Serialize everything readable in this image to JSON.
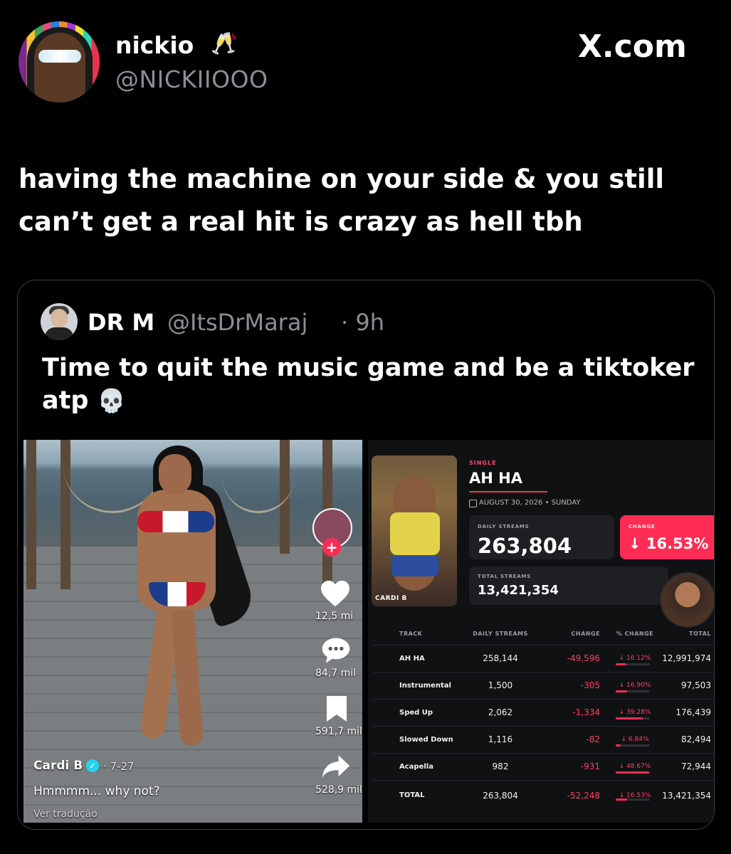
{
  "tweet": {
    "user_name": "nickio",
    "name_emoji": "🥂",
    "user_handle": "@NICKIIOOO",
    "site": "X.com",
    "text": "having the machine on your side & you still can’t get a real hit is crazy as hell tbh"
  },
  "quote": {
    "name": "DR M",
    "handle": "@ItsDrMaraj",
    "time": "· 9h",
    "text": "Time to quit the music game and be a tiktoker atp",
    "emoji": "💀"
  },
  "video": {
    "like_count": "12,5 mi",
    "comment_count": "84,7 mil",
    "save_count": "591,7 mil",
    "share_count": "528,9 mil",
    "follow_symbol": "+",
    "creator": "Cardi B",
    "verified_symbol": "✓",
    "date": "· 7-27",
    "caption": "Hmmmm... why not?",
    "translation": "Ver tradução"
  },
  "stats": {
    "release_type": "SINGLE",
    "title": "AH HA",
    "date": "AUGUST 30, 2026 • SUNDAY",
    "artist": "CARDI B",
    "daily_label": "DAILY STREAMS",
    "daily_value": "263,804",
    "change_label": "CHANGE",
    "change_value": "↓ 16.53%",
    "total_label": "TOTAL STREAMS",
    "total_value": "13,421,354",
    "accent_color": "#ff2d55",
    "table": {
      "headers": {
        "track": "TRACK",
        "daily": "DAILY STREAMS",
        "change": "CHANGE",
        "pct": "% CHANGE",
        "total": "TOTAL"
      },
      "rows": [
        {
          "track": "AH HA",
          "daily": "258,144",
          "change": "-49,596",
          "pct": "↓ 16.12%",
          "pct_value": 16.12,
          "total": "12,991,974"
        },
        {
          "track": "Instrumental",
          "daily": "1,500",
          "change": "-305",
          "pct": "↓ 16.90%",
          "pct_value": 16.9,
          "total": "97,503"
        },
        {
          "track": "Sped Up",
          "daily": "2,062",
          "change": "-1,334",
          "pct": "↓ 39.28%",
          "pct_value": 39.28,
          "total": "176,439"
        },
        {
          "track": "Slowed Down",
          "daily": "1,116",
          "change": "-82",
          "pct": "↓ 6.84%",
          "pct_value": 6.84,
          "total": "82,494"
        },
        {
          "track": "Acapella",
          "daily": "982",
          "change": "-931",
          "pct": "↓ 48.67%",
          "pct_value": 48.67,
          "total": "72,944"
        },
        {
          "track": "TOTAL",
          "daily": "263,804",
          "change": "-52,248",
          "pct": "↓ 16.53%",
          "pct_value": 16.53,
          "total": "13,421,354"
        }
      ]
    }
  }
}
